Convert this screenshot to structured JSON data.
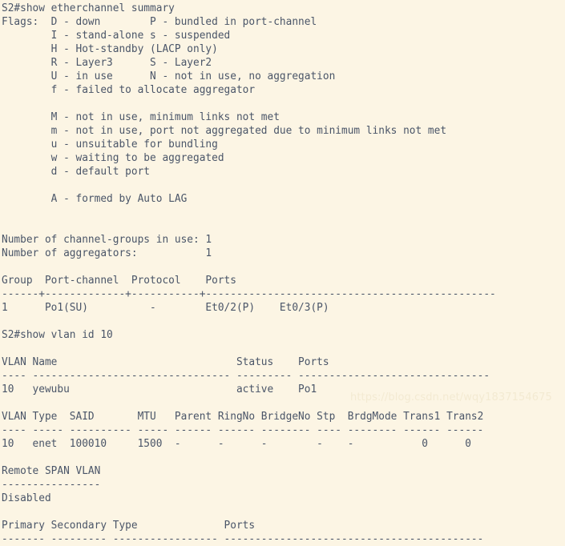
{
  "terminal": {
    "background_color": "#fcf5e4",
    "text_color": "#4a5568",
    "watermark_color": "#f3ead2",
    "device_prompt": "S2#",
    "watermark": "https://blog.csdn.net/wqy1837154675",
    "commands": [
      "show etherchannel summary",
      "show vlan id 10"
    ],
    "lines": [
      "S2#show etherchannel summary",
      "Flags:  D - down        P - bundled in port-channel",
      "        I - stand-alone s - suspended",
      "        H - Hot-standby (LACP only)",
      "        R - Layer3      S - Layer2",
      "        U - in use      N - not in use, no aggregation",
      "        f - failed to allocate aggregator",
      "",
      "        M - not in use, minimum links not met",
      "        m - not in use, port not aggregated due to minimum links not met",
      "        u - unsuitable for bundling",
      "        w - waiting to be aggregated",
      "        d - default port",
      "",
      "        A - formed by Auto LAG",
      "",
      "",
      "Number of channel-groups in use: 1",
      "Number of aggregators:           1",
      "",
      "Group  Port-channel  Protocol    Ports",
      "------+-------------+-----------+-----------------------------------------------",
      "1      Po1(SU)          -        Et0/2(P)    Et0/3(P)",
      "",
      "S2#show vlan id 10",
      "",
      "VLAN Name                             Status    Ports",
      "---- -------------------------------- --------- -------------------------------",
      "10   yewubu                           active    Po1",
      "",
      "VLAN Type  SAID       MTU   Parent RingNo BridgeNo Stp  BrdgMode Trans1 Trans2",
      "---- ----- ---------- ----- ------ ------ -------- ---- -------- ------ ------",
      "10   enet  100010     1500  -      -      -        -    -           0      0",
      "",
      "Remote SPAN VLAN",
      "----------------",
      "Disabled",
      "",
      "Primary Secondary Type              Ports",
      "------- --------- ----------------- ------------------------------------------"
    ]
  },
  "etherchannel_summary": {
    "flags_label": "Flags:",
    "flags": [
      {
        "code": "D",
        "description": "down"
      },
      {
        "code": "P",
        "description": "bundled in port-channel"
      },
      {
        "code": "I",
        "description": "stand-alone"
      },
      {
        "code": "s",
        "description": "suspended"
      },
      {
        "code": "H",
        "description": "Hot-standby (LACP only)"
      },
      {
        "code": "R",
        "description": "Layer3"
      },
      {
        "code": "S",
        "description": "Layer2"
      },
      {
        "code": "U",
        "description": "in use"
      },
      {
        "code": "N",
        "description": "not in use, no aggregation"
      },
      {
        "code": "f",
        "description": "failed to allocate aggregator"
      },
      {
        "code": "M",
        "description": "not in use, minimum links not met"
      },
      {
        "code": "m",
        "description": "not in use, port not aggregated due to minimum links not met"
      },
      {
        "code": "u",
        "description": "unsuitable for bundling"
      },
      {
        "code": "w",
        "description": "waiting to be aggregated"
      },
      {
        "code": "d",
        "description": "default port"
      },
      {
        "code": "A",
        "description": "formed by Auto LAG"
      }
    ],
    "channel_groups_in_use_label": "Number of channel-groups in use:",
    "channel_groups_in_use": "1",
    "aggregators_label": "Number of aggregators:",
    "aggregators": "1",
    "table_headers": [
      "Group",
      "Port-channel",
      "Protocol",
      "Ports"
    ],
    "rows": [
      {
        "group": "1",
        "port_channel": "Po1(SU)",
        "protocol": "-",
        "ports": [
          "Et0/2(P)",
          "Et0/3(P)"
        ]
      }
    ]
  },
  "vlan_id_10": {
    "headers": [
      "VLAN",
      "Name",
      "Status",
      "Ports"
    ],
    "rows": [
      {
        "vlan": "10",
        "name": "yewubu",
        "status": "active",
        "ports": "Po1"
      }
    ],
    "detail_headers": [
      "VLAN",
      "Type",
      "SAID",
      "MTU",
      "Parent",
      "RingNo",
      "BridgeNo",
      "Stp",
      "BrdgMode",
      "Trans1",
      "Trans2"
    ],
    "detail_rows": [
      {
        "vlan": "10",
        "type": "enet",
        "said": "100010",
        "mtu": "1500",
        "parent": "-",
        "ringno": "-",
        "bridgeno": "-",
        "stp": "-",
        "brdgmode": "-",
        "trans1": "0",
        "trans2": "0"
      }
    ],
    "remote_span_vlan_label": "Remote SPAN VLAN",
    "remote_span_vlan_value": "Disabled",
    "private_vlan_headers": [
      "Primary",
      "Secondary",
      "Type",
      "Ports"
    ]
  }
}
